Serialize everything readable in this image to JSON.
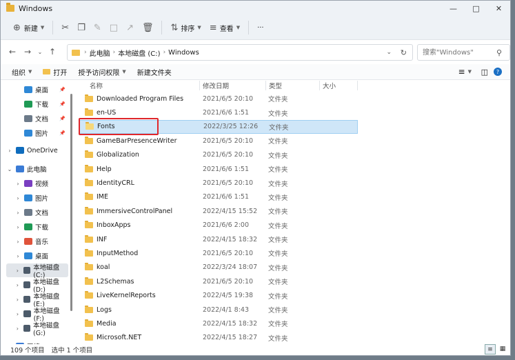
{
  "window": {
    "title": "Windows"
  },
  "toolbar": {
    "new_label": "新建",
    "sort_label": "排序",
    "view_label": "查看",
    "more_label": "···"
  },
  "address": {
    "crumbs": [
      "此电脑",
      "本地磁盘 (C:)",
      "Windows"
    ]
  },
  "search": {
    "placeholder": "搜索\"Windows\""
  },
  "cmdbar": {
    "organize": "组织",
    "open": "打开",
    "share": "授予访问权限",
    "new_folder": "新建文件夹"
  },
  "sidebar": {
    "items": [
      {
        "label": "桌面",
        "pinned": true,
        "color": "#2f88d6"
      },
      {
        "label": "下载",
        "pinned": true,
        "color": "#1f9a55"
      },
      {
        "label": "文档",
        "pinned": true,
        "color": "#6c7a89"
      },
      {
        "label": "图片",
        "pinned": true,
        "color": "#2f88d6"
      },
      {
        "label": "OneDrive",
        "expandable": true,
        "color": "#0f6cbd"
      },
      {
        "label": "此电脑",
        "expanded": true,
        "color": "#3a7bd5"
      },
      {
        "label": "视频",
        "expandable": true,
        "color": "#7a3fc1"
      },
      {
        "label": "图片",
        "expandable": true,
        "color": "#2f88d6"
      },
      {
        "label": "文档",
        "expandable": true,
        "color": "#6c7a89"
      },
      {
        "label": "下载",
        "expandable": true,
        "color": "#1f9a55"
      },
      {
        "label": "音乐",
        "expandable": true,
        "color": "#e0533b"
      },
      {
        "label": "桌面",
        "expandable": true,
        "color": "#2f88d6"
      },
      {
        "label": "本地磁盘 (C:)",
        "expandable": true,
        "selected": true,
        "color": "#4d5b6a"
      },
      {
        "label": "本地磁盘 (D:)",
        "expandable": true,
        "color": "#4d5b6a"
      },
      {
        "label": "本地磁盘 (E:)",
        "expandable": true,
        "color": "#4d5b6a"
      },
      {
        "label": "本地磁盘 (F:)",
        "expandable": true,
        "color": "#4d5b6a"
      },
      {
        "label": "本地磁盘 (G:)",
        "expandable": true,
        "color": "#4d5b6a"
      },
      {
        "label": "网络",
        "expandable": true,
        "color": "#3a7bd5"
      }
    ]
  },
  "columns": {
    "name": "名称",
    "date": "修改日期",
    "type": "类型",
    "size": "大小"
  },
  "files": [
    {
      "name": "Downloaded Program Files",
      "date": "2021/6/5 20:10",
      "type": "文件夹"
    },
    {
      "name": "en-US",
      "date": "2021/6/6 1:51",
      "type": "文件夹"
    },
    {
      "name": "Fonts",
      "date": "2022/3/25 12:26",
      "type": "文件夹",
      "selected": true,
      "font_icon": true
    },
    {
      "name": "GameBarPresenceWriter",
      "date": "2021/6/5 20:10",
      "type": "文件夹"
    },
    {
      "name": "Globalization",
      "date": "2021/6/5 20:10",
      "type": "文件夹"
    },
    {
      "name": "Help",
      "date": "2021/6/6 1:51",
      "type": "文件夹"
    },
    {
      "name": "IdentityCRL",
      "date": "2021/6/5 20:10",
      "type": "文件夹"
    },
    {
      "name": "IME",
      "date": "2021/6/6 1:51",
      "type": "文件夹"
    },
    {
      "name": "ImmersiveControlPanel",
      "date": "2022/4/15 15:52",
      "type": "文件夹"
    },
    {
      "name": "InboxApps",
      "date": "2021/6/6 2:00",
      "type": "文件夹"
    },
    {
      "name": "INF",
      "date": "2022/4/15 18:32",
      "type": "文件夹"
    },
    {
      "name": "InputMethod",
      "date": "2021/6/5 20:10",
      "type": "文件夹"
    },
    {
      "name": "koal",
      "date": "2022/3/24 18:07",
      "type": "文件夹"
    },
    {
      "name": "L2Schemas",
      "date": "2021/6/5 20:10",
      "type": "文件夹"
    },
    {
      "name": "LiveKernelReports",
      "date": "2022/4/5 19:38",
      "type": "文件夹"
    },
    {
      "name": "Logs",
      "date": "2022/4/1 8:43",
      "type": "文件夹"
    },
    {
      "name": "Media",
      "date": "2022/4/15 18:32",
      "type": "文件夹"
    },
    {
      "name": "Microsoft.NET",
      "date": "2022/4/15 18:27",
      "type": "文件夹"
    }
  ],
  "status": {
    "count": "109 个项目",
    "selected": "选中 1 个项目"
  }
}
